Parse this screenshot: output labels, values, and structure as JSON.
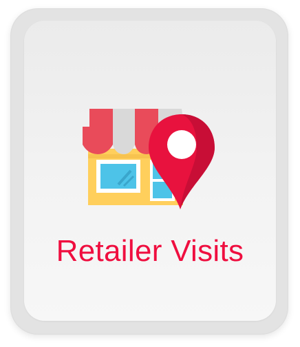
{
  "card": {
    "title": "Retailer Visits",
    "icon": "store-location-pin-icon"
  },
  "colors": {
    "accent": "#ef0e3f",
    "awning_red": "#ea4a5a",
    "awning_gray": "#cfcfcf",
    "store_body": "#ffcf5c",
    "window_blue": "#4dc3e8",
    "pin_red": "#e8123e"
  }
}
